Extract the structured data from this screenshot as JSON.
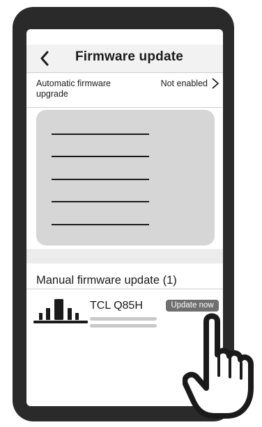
{
  "header": {
    "back_icon": "chevron-left-icon",
    "title": "Firmware update"
  },
  "auto_upgrade": {
    "label": "Automatic firmware upgrade",
    "status": "Not enabled",
    "chevron_icon": "chevron-right-icon"
  },
  "placeholder_panel": {
    "color": "#d6d6d6",
    "line_count": 5
  },
  "manual": {
    "title": "Manual firmware update (1)",
    "devices": [
      {
        "name": "TCL Q85H",
        "icon": "soundbar-icon",
        "button_label": "Update now",
        "button_color": "#6f6f6f"
      }
    ]
  },
  "colors": {
    "phone_frame": "#2a2a2a",
    "header_bg": "#f2f2f2"
  }
}
